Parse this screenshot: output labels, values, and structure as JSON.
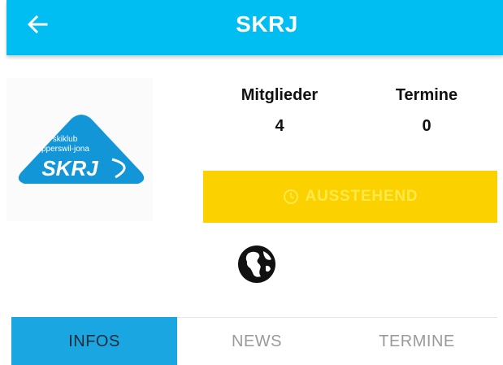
{
  "appbar": {
    "title": "SKRJ",
    "back_icon": "arrow-left-icon",
    "background": "#00bdf2"
  },
  "club_logo": {
    "line1": "skiklub",
    "line2": "rapperswil-jona",
    "wordmark": "SKRJ",
    "color": "#1296d8"
  },
  "stats": {
    "members_label": "Mitglieder",
    "members_value": "4",
    "events_label": "Termine",
    "events_value": "0"
  },
  "status": {
    "label": "AUSSTEHEND",
    "icon": "clock-icon",
    "background": "#fcd100"
  },
  "website": {
    "icon": "globe-icon"
  },
  "tabs": [
    {
      "label": "INFOS",
      "active": true
    },
    {
      "label": "NEWS",
      "active": false
    },
    {
      "label": "TERMINE",
      "active": false
    }
  ],
  "colors": {
    "accent": "#1aa6e0",
    "inactive_tab_text": "#9a9a9a"
  }
}
